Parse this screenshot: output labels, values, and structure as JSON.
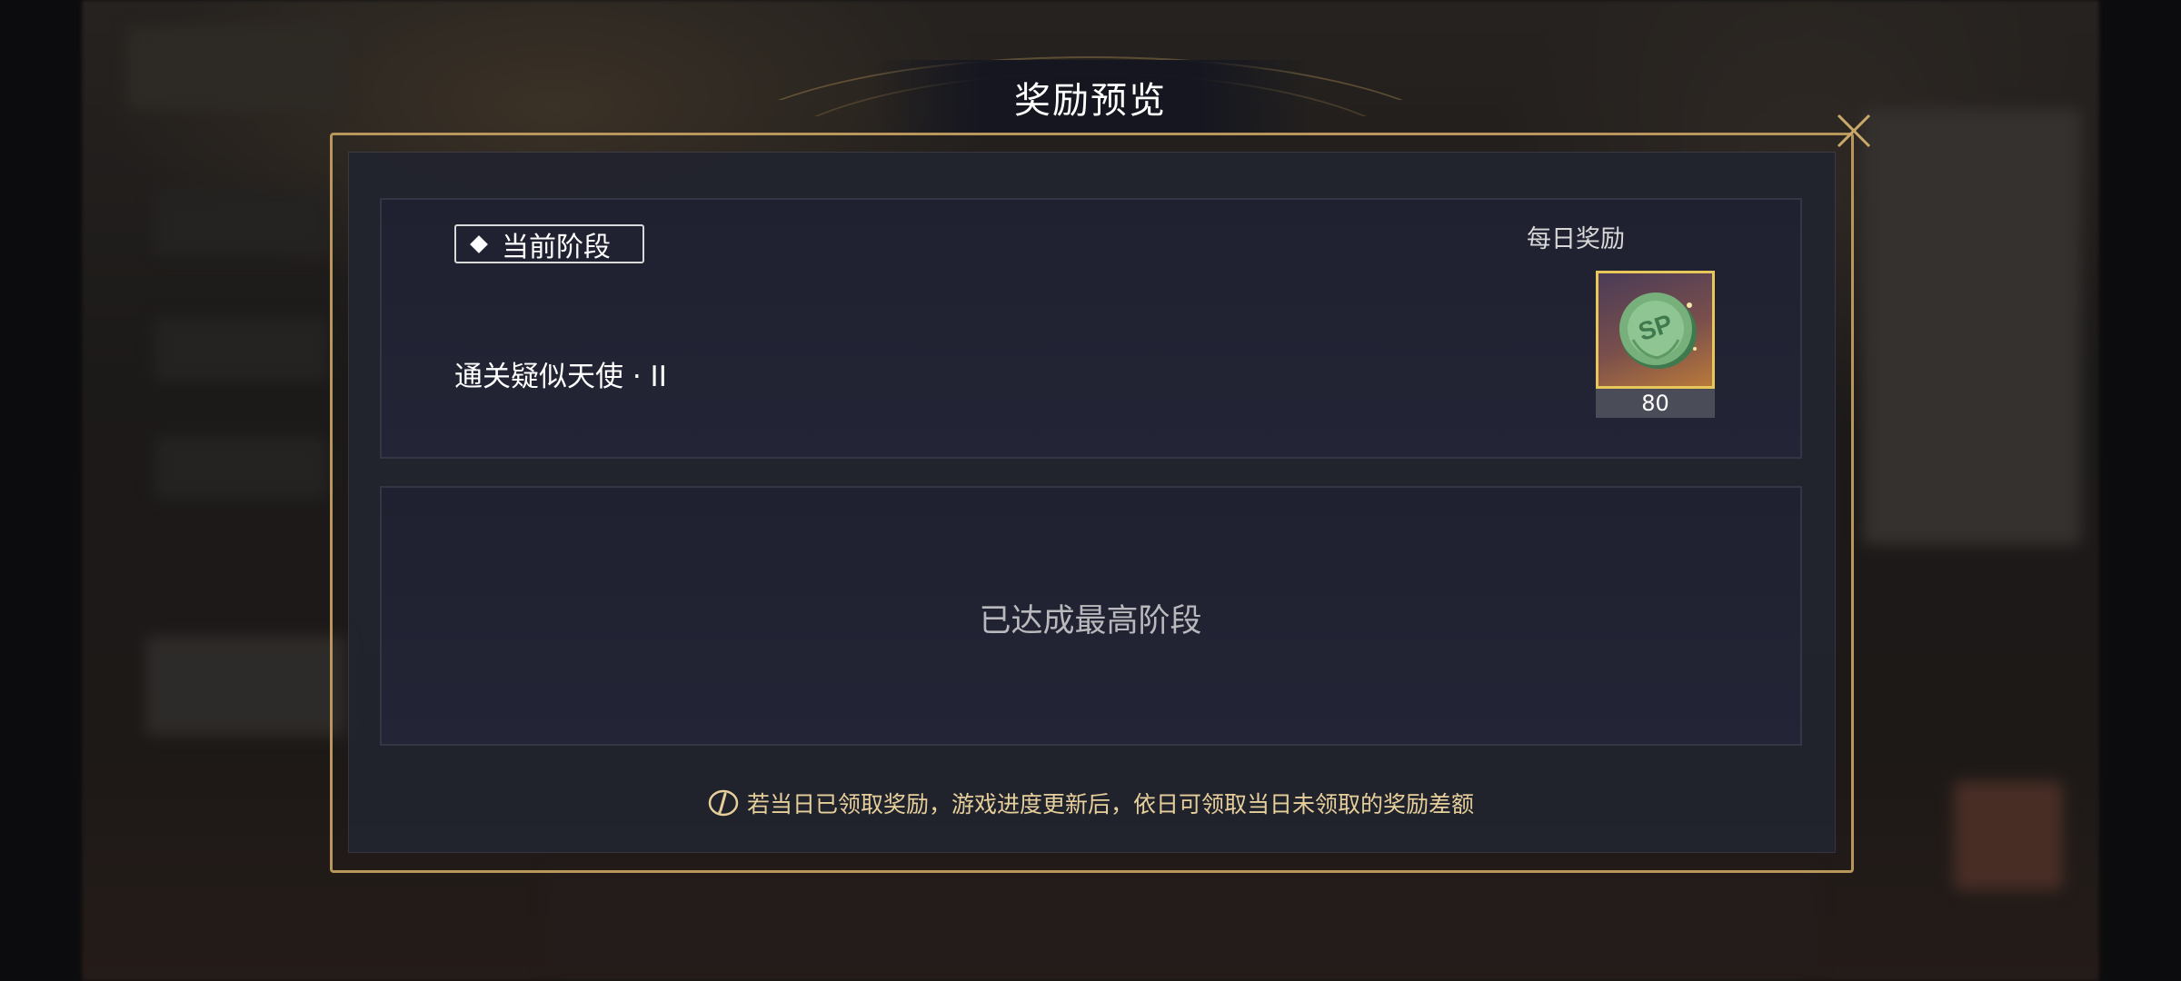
{
  "dialog": {
    "title": "奖励预览",
    "close_icon": "close-icon",
    "current_stage": {
      "tag_label": "当前阶段",
      "tag_icon": "diamond-icon",
      "condition": "通关疑似天使 · II",
      "daily_reward_label": "每日奖励",
      "reward": {
        "icon": "sp-coin-icon",
        "coin_text": "SP",
        "count": "80"
      }
    },
    "next_stage": {
      "message": "已达成最高阶段"
    },
    "notice": {
      "icon": "info-icon",
      "text": "若当日已领取奖励，游戏进度更新后，依日可领取当日未领取的奖励差额"
    }
  },
  "colors": {
    "gold_frame": "#b8965c",
    "panel_bg": "#21232e",
    "reward_border": "#e8c75a",
    "notice_text": "#e7cf9c"
  }
}
